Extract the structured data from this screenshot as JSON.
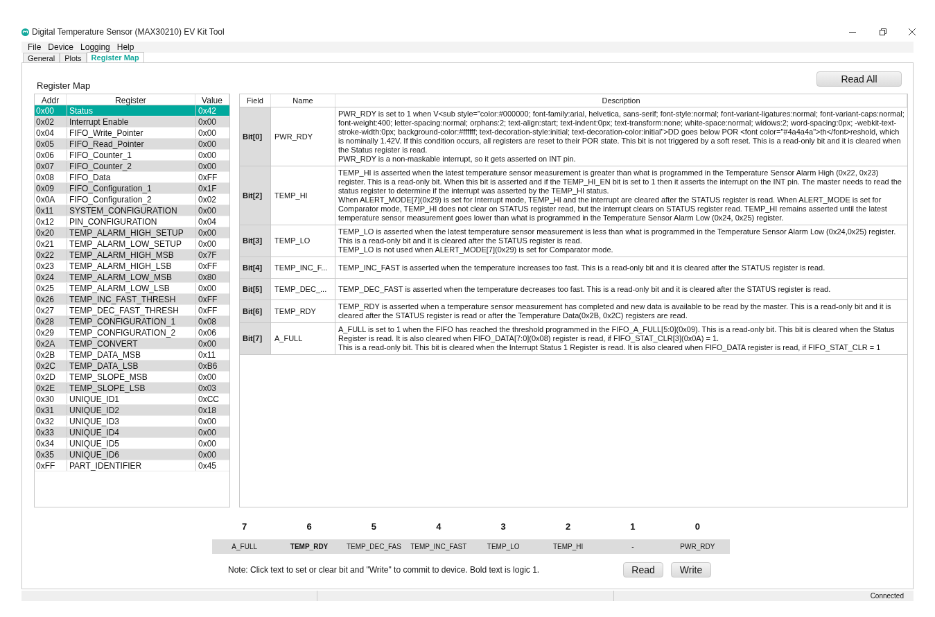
{
  "window": {
    "title": "Digital Temperature Sensor (MAX30210) EV Kit Tool"
  },
  "menu": [
    "File",
    "Device",
    "Logging",
    "Help"
  ],
  "tabs": [
    {
      "label": "General",
      "selected": false
    },
    {
      "label": "Plots",
      "selected": false
    },
    {
      "label": "Register Map",
      "selected": true
    }
  ],
  "register_map": {
    "title": "Register Map",
    "columns": [
      "Addr",
      "Register",
      "Value"
    ],
    "rows": [
      {
        "addr": "0x00",
        "register": "Status",
        "value": "0x42",
        "selected": true
      },
      {
        "addr": "0x02",
        "register": "Interrupt Enable",
        "value": "0x00",
        "selected": false
      },
      {
        "addr": "0x04",
        "register": "FIFO_Write_Pointer",
        "value": "0x00",
        "selected": false
      },
      {
        "addr": "0x05",
        "register": "FIFO_Read_Pointer",
        "value": "0x00",
        "selected": false
      },
      {
        "addr": "0x06",
        "register": "FIFO_Counter_1",
        "value": "0x00",
        "selected": false
      },
      {
        "addr": "0x07",
        "register": "FIFO_Counter_2",
        "value": "0x00",
        "selected": false
      },
      {
        "addr": "0x08",
        "register": "FIFO_Data",
        "value": "0xFF",
        "selected": false
      },
      {
        "addr": "0x09",
        "register": "FIFO_Configuration_1",
        "value": "0x1F",
        "selected": false
      },
      {
        "addr": "0x0A",
        "register": "FIFO_Configuration_2",
        "value": "0x02",
        "selected": false
      },
      {
        "addr": "0x11",
        "register": "SYSTEM_CONFIGURATION",
        "value": "0x00",
        "selected": false
      },
      {
        "addr": "0x12",
        "register": "PIN_CONFIGURATION",
        "value": "0x04",
        "selected": false
      },
      {
        "addr": "0x20",
        "register": "TEMP_ALARM_HIGH_SETUP",
        "value": "0x00",
        "selected": false
      },
      {
        "addr": "0x21",
        "register": "TEMP_ALARM_LOW_SETUP",
        "value": "0x00",
        "selected": false
      },
      {
        "addr": "0x22",
        "register": "TEMP_ALARM_HIGH_MSB",
        "value": "0x7F",
        "selected": false
      },
      {
        "addr": "0x23",
        "register": "TEMP_ALARM_HIGH_LSB",
        "value": "0xFF",
        "selected": false
      },
      {
        "addr": "0x24",
        "register": "TEMP_ALARM_LOW_MSB",
        "value": "0x80",
        "selected": false
      },
      {
        "addr": "0x25",
        "register": "TEMP_ALARM_LOW_LSB",
        "value": "0x00",
        "selected": false
      },
      {
        "addr": "0x26",
        "register": "TEMP_INC_FAST_THRESH",
        "value": "0xFF",
        "selected": false
      },
      {
        "addr": "0x27",
        "register": "TEMP_DEC_FAST_THRESH",
        "value": "0xFF",
        "selected": false
      },
      {
        "addr": "0x28",
        "register": "TEMP_CONFIGURATION_1",
        "value": "0x08",
        "selected": false
      },
      {
        "addr": "0x29",
        "register": "TEMP_CONFIGURATION_2",
        "value": "0x06",
        "selected": false
      },
      {
        "addr": "0x2A",
        "register": "TEMP_CONVERT",
        "value": "0x00",
        "selected": false
      },
      {
        "addr": "0x2B",
        "register": "TEMP_DATA_MSB",
        "value": "0x11",
        "selected": false
      },
      {
        "addr": "0x2C",
        "register": "TEMP_DATA_LSB",
        "value": "0xB6",
        "selected": false
      },
      {
        "addr": "0x2D",
        "register": "TEMP_SLOPE_MSB",
        "value": "0x00",
        "selected": false
      },
      {
        "addr": "0x2E",
        "register": "TEMP_SLOPE_LSB",
        "value": "0x03",
        "selected": false
      },
      {
        "addr": "0x30",
        "register": "UNIQUE_ID1",
        "value": "0xCC",
        "selected": false
      },
      {
        "addr": "0x31",
        "register": "UNIQUE_ID2",
        "value": "0x18",
        "selected": false
      },
      {
        "addr": "0x32",
        "register": "UNIQUE_ID3",
        "value": "0x00",
        "selected": false
      },
      {
        "addr": "0x33",
        "register": "UNIQUE_ID4",
        "value": "0x00",
        "selected": false
      },
      {
        "addr": "0x34",
        "register": "UNIQUE_ID5",
        "value": "0x00",
        "selected": false
      },
      {
        "addr": "0x35",
        "register": "UNIQUE_ID6",
        "value": "0x00",
        "selected": false
      },
      {
        "addr": "0xFF",
        "register": "PART_IDENTIFIER",
        "value": "0x45",
        "selected": false
      }
    ]
  },
  "read_all_button": "Read All",
  "fields_table": {
    "columns": [
      "Field",
      "Name",
      "Description"
    ],
    "rows": [
      {
        "field": "Bit[0]",
        "name": "PWR_RDY",
        "description": [
          "PWR_RDY is set to 1 when V<sub style=\"color:#000000; font-family:arial, helvetica, sans-serif; font-style:normal; font-variant-ligatures:normal; font-variant-caps:normal; font-weight:400; letter-spacing:normal; orphans:2; text-align:start; text-indent:0px; text-transform:none; white-space:normal; widows:2; word-spacing:0px; -webkit-text-stroke-width:0px; background-color:#ffffff; text-decoration-style:initial; text-decoration-color:initial\">DD goes below POR <font color=\"#4a4a4a\">th</font>reshold, which is nominally 1.42V. If this condition occurs, all registers are reset to their POR state. This bit is not triggered by a soft reset. This is a read-only bit and it is cleared when the Status register is read.",
          "PWR_RDY is a non-maskable interrupt, so it gets asserted on INT pin."
        ]
      },
      {
        "field": "Bit[2]",
        "name": "TEMP_HI",
        "description": [
          "TEMP_HI is asserted when the latest temperature sensor measurement is greater than what is programmed in the Temperature Sensor Alarm High (0x22, 0x23) register. This is a read-only bit. When this bit is asserted and if the TEMP_HI_EN bit is set to 1 then it asserts the interrupt on the INT pin. The master needs to read the status register to determine if the interrupt was asserted by the TEMP_HI status.",
          "When ALERT_MODE[7](0x29) is set for Interrupt mode, TEMP_HI and the interrupt are cleared after the STATUS register is read. When ALERT_MODE is set for Comparator mode, TEMP_HI does not clear on STATUS register read, but the interrupt clears on STATUS register read. TEMP_HI remains asserted until the latest temperature sensor measurement goes lower than what is programmed in the Temperature Sensor Alarm Low (0x24, 0x25) register."
        ]
      },
      {
        "field": "Bit[3]",
        "name": "TEMP_LO",
        "description": [
          "TEMP_LO is asserted when the latest temperature sensor measurement is less than what is programmed in the Temperature Sensor Alarm Low (0x24,0x25) register. This is a read-only bit and it is cleared after the STATUS register is read.",
          "TEMP_LO is not used when ALERT_MODE[7](0x29) is set for Comparator mode."
        ]
      },
      {
        "field": "Bit[4]",
        "name": "TEMP_INC_F...",
        "description": [
          "TEMP_INC_FAST is asserted when the temperature increases too fast. This is a read-only bit and it is cleared after the STATUS register is read."
        ]
      },
      {
        "field": "Bit[5]",
        "name": "TEMP_DEC_...",
        "description": [
          "TEMP_DEC_FAST is asserted when the temperature decreases too fast. This is a read-only bit and it is cleared after the STATUS register is read."
        ]
      },
      {
        "field": "Bit[6]",
        "name": "TEMP_RDY",
        "description": [
          "TEMP_RDY is asserted when a temperature sensor measurement has completed and new data is available to be read by the master. This is a read-only bit and it is cleared after the STATUS register is read or after the Temperature Data(0x2B, 0x2C) registers are read."
        ]
      },
      {
        "field": "Bit[7]",
        "name": "A_FULL",
        "description": [
          "A_FULL is set to 1 when the FIFO has reached the threshold programmed in the FIFO_A_FULL[5:0](0x09). This is a read-only bit. This bit is cleared when the Status Register is read. It is also cleared when FIFO_DATA[7:0](0x08) register is read, if FIFO_STAT_CLR[3](0x0A) = 1.",
          "This is a read-only bit. This bit is cleared when the Interrupt Status 1 Register is read. It is also cleared when FIFO_DATA register is read, if FIFO_STAT_CLR = 1"
        ]
      }
    ]
  },
  "bits": [
    {
      "number": "7",
      "label": "A_FULL",
      "on": false
    },
    {
      "number": "6",
      "label": "TEMP_RDY",
      "on": true
    },
    {
      "number": "5",
      "label": "TEMP_DEC_FAS",
      "on": false
    },
    {
      "number": "4",
      "label": "TEMP_INC_FAST",
      "on": false
    },
    {
      "number": "3",
      "label": "TEMP_LO",
      "on": false
    },
    {
      "number": "2",
      "label": "TEMP_HI",
      "on": false
    },
    {
      "number": "1",
      "label": "-",
      "on": false
    },
    {
      "number": "0",
      "label": "PWR_RDY",
      "on": false
    }
  ],
  "note": "Note: Click text to set or clear bit and \"Write\" to commit to device. Bold text is logic 1.",
  "buttons": [
    "Read",
    "Write"
  ],
  "status_bar": {
    "status": "Connected"
  }
}
